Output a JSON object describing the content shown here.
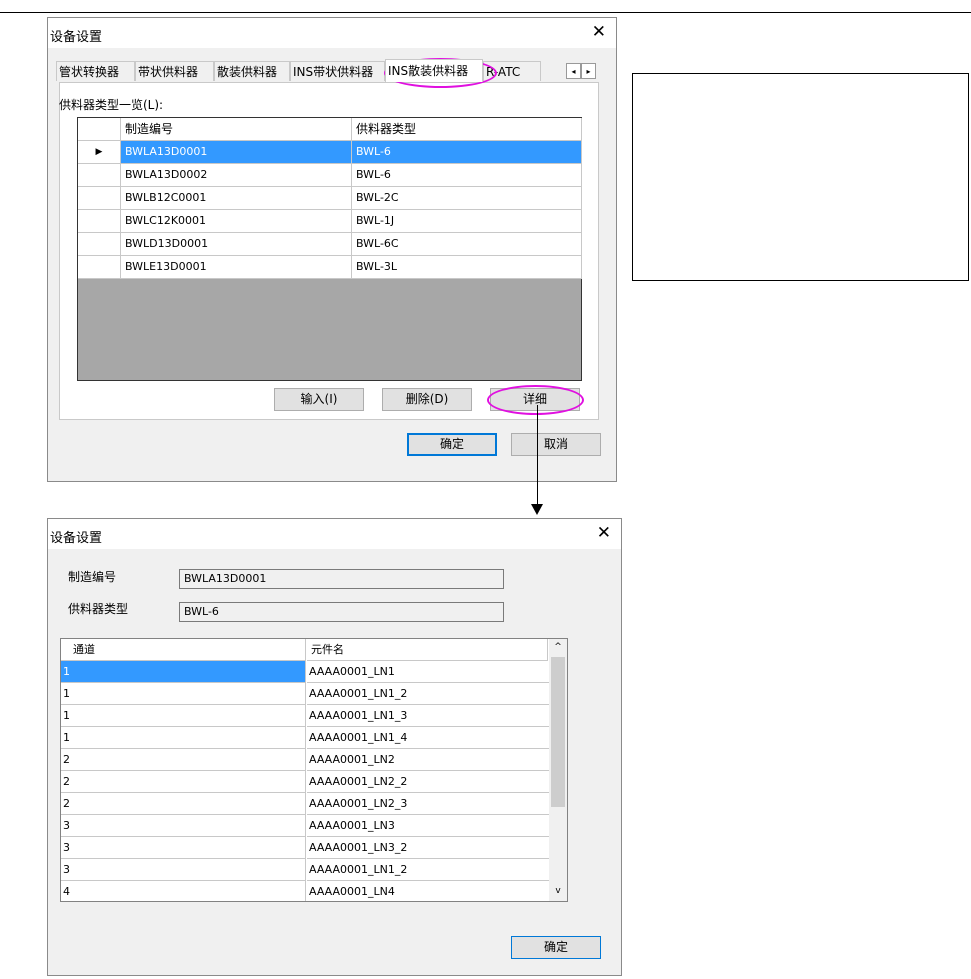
{
  "dialog1": {
    "title": "设备设置",
    "close": "✕",
    "tabs": [
      "管状转换器",
      "带状供料器",
      "散装供料器",
      "INS带状供料器",
      "INS散装供料器",
      "R-ATC"
    ],
    "active_tab": "INS散装供料器",
    "scroll_left": "◂",
    "scroll_right": "▸",
    "list_label": "供料器类型一览(L):",
    "columns": [
      "制造编号",
      "供料器类型"
    ],
    "row_marker": "▶",
    "rows": [
      {
        "serial": "BWLA13D0001",
        "type": "BWL-6"
      },
      {
        "serial": "BWLA13D0002",
        "type": "BWL-6"
      },
      {
        "serial": "BWLB12C0001",
        "type": "BWL-2C"
      },
      {
        "serial": "BWLC12K0001",
        "type": "BWL-1J"
      },
      {
        "serial": "BWLD13D0001",
        "type": "BWL-6C"
      },
      {
        "serial": "BWLE13D0001",
        "type": "BWL-3L"
      }
    ],
    "selected_row": 0,
    "buttons": {
      "import": "输入(I)",
      "delete": "删除(D)",
      "detail": "详细",
      "ok": "确定",
      "cancel": "取消"
    }
  },
  "dialog2": {
    "title": "设备设置",
    "close": "✕",
    "serial_label": "制造编号",
    "serial_value": "BWLA13D0001",
    "type_label": "供料器类型",
    "type_value": "BWL-6",
    "columns": [
      "通道",
      "元件名"
    ],
    "rows": [
      {
        "channel": "1",
        "part": "AAAA0001_LN1"
      },
      {
        "channel": "1",
        "part": "AAAA0001_LN1_2"
      },
      {
        "channel": "1",
        "part": "AAAA0001_LN1_3"
      },
      {
        "channel": "1",
        "part": "AAAA0001_LN1_4"
      },
      {
        "channel": "2",
        "part": "AAAA0001_LN2"
      },
      {
        "channel": "2",
        "part": "AAAA0001_LN2_2"
      },
      {
        "channel": "2",
        "part": "AAAA0001_LN2_3"
      },
      {
        "channel": "3",
        "part": "AAAA0001_LN3"
      },
      {
        "channel": "3",
        "part": "AAAA0001_LN3_2"
      },
      {
        "channel": "3",
        "part": "AAAA0001_LN1_2"
      },
      {
        "channel": "4",
        "part": "AAAA0001_LN4"
      }
    ],
    "selected_row": 0,
    "scroll_up": "^",
    "scroll_down": "v",
    "ok_button": "确定"
  },
  "colors": {
    "selection": "#3399ff",
    "highlight": "#e010e0",
    "dialog_bg": "#f0f0f0"
  }
}
